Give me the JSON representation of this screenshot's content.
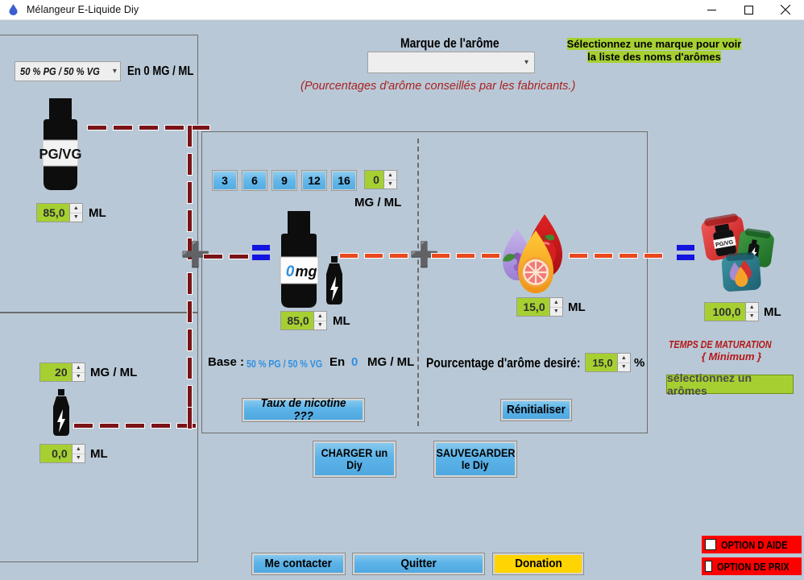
{
  "window": {
    "title": "Mélangeur E-Liquide Diy",
    "icon": "droplet-icon",
    "minimize": "minimize-icon",
    "maximize": "maximize-icon",
    "close": "close-icon"
  },
  "left_panel": {
    "pgvg_select": {
      "value": "50 % PG / 50 % VG",
      "arrow": "chevron-down-icon"
    },
    "pgvg_suffix": "En 0 MG / ML",
    "bottle_label": "PG/VG",
    "pgvg_ml": {
      "value": "85,0",
      "unit": "ML"
    },
    "nicotine_mgml": {
      "value": "20",
      "unit": "MG / ML"
    },
    "nicotine_ml": {
      "value": "0,0",
      "unit": "ML"
    }
  },
  "header": {
    "brand_label": "Marque de l'arôme",
    "brand_select_value": "",
    "brand_arrow": "chevron-down-icon",
    "advice_line1": "Sélectionnez une marque pour voir",
    "advice_line2": "la liste des noms d'arômes",
    "note": "(Pourcentages d'arôme conseillés par les fabricants.)"
  },
  "center": {
    "nicotine_presets": [
      "3",
      "6",
      "9",
      "12",
      "16"
    ],
    "nicotine_spin": {
      "value": "0",
      "unit": "MG / ML"
    },
    "base_bottle_value": "0",
    "base_bottle_unit": "mg",
    "base_ml": {
      "value": "85,0",
      "unit": "ML"
    },
    "base_line": {
      "label": "Base :",
      "ratio": "50 % PG / 50 % VG",
      "en": "En",
      "mg": "0",
      "unit": "MG / ML"
    },
    "nicotine_button": "Taux de nicotine ???",
    "aroma_ml": {
      "value": "15,0",
      "unit": "ML"
    },
    "aroma_percent_label": "Pourcentage  d'arôme desiré:",
    "aroma_percent": {
      "value": "15,0",
      "unit": "%"
    },
    "reset_button": "Rénitialiser"
  },
  "result": {
    "total_ml": {
      "value": "100,0",
      "unit": "ML"
    },
    "maturation_line1": "TEMPS DE MATURATION",
    "maturation_line2": "{ Minimum }",
    "maturation_value": "sélectionnez un arômes"
  },
  "actions": {
    "load": {
      "line1": "CHARGER  un",
      "line2": "Diy"
    },
    "save": {
      "line1": "SAUVEGARDER",
      "line2": "le Diy"
    },
    "contact": "Me contacter",
    "quit": "Quitter",
    "donation": "Donation"
  },
  "options": [
    {
      "label": "OPTION D AIDE",
      "checked": false
    },
    {
      "label": "OPTION DE PRIX",
      "checked": false
    }
  ],
  "colors": {
    "background": "#b9c8d6",
    "green_field": "#a6d032",
    "blue_button": "#5cb3e8",
    "red_option": "#ff0000",
    "dash_dark_red": "#7b1418",
    "dash_orange": "#e8491f",
    "operator_blue": "#1414e0",
    "maturation_red": "#b41818",
    "yellow_button": "#ffd400"
  }
}
